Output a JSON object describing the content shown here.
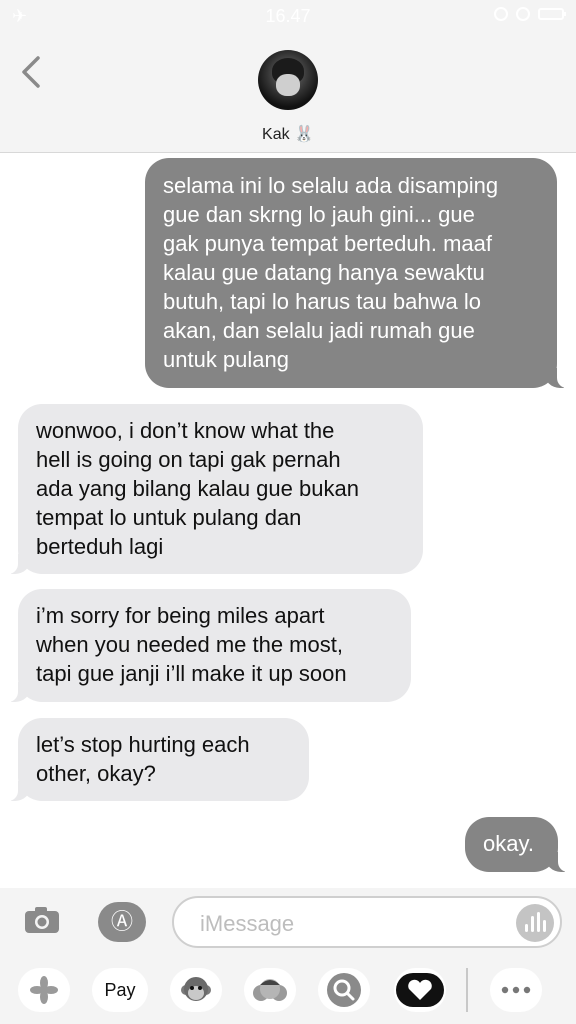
{
  "status": {
    "time": "16.47"
  },
  "header": {
    "contact_name": "Kak 🐰"
  },
  "messages": [
    {
      "from": "me",
      "lines": [
        "selama ini lo selalu ada disamping",
        "gue dan skrng lo jauh gini... gue",
        "gak punya tempat berteduh. maaf",
        "kalau gue datang hanya sewaktu",
        "butuh, tapi lo harus tau bahwa lo",
        "akan, dan selalu jadi rumah gue",
        "untuk pulang"
      ]
    },
    {
      "from": "them",
      "lines": [
        "wonwoo, i don’t know what the",
        "hell is going on tapi gak pernah",
        "ada yang bilang kalau gue bukan",
        "tempat lo untuk pulang dan",
        "berteduh lagi"
      ]
    },
    {
      "from": "them",
      "lines": [
        "i’m sorry for being miles apart",
        "when you needed me the most,",
        "tapi gue janji i’ll make it up soon"
      ]
    },
    {
      "from": "them",
      "lines": [
        "let’s stop hurting each",
        "other, okay?"
      ]
    },
    {
      "from": "me",
      "lines": [
        "okay."
      ]
    }
  ],
  "input": {
    "placeholder": "iMessage"
  },
  "app_drawer": {
    "items": [
      {
        "name": "photos",
        "icon": "photos-icon"
      },
      {
        "name": "apple-pay",
        "label": "Pay",
        "icon": "apple-pay-icon"
      },
      {
        "name": "animoji",
        "icon": "monkey-animoji-icon"
      },
      {
        "name": "memoji",
        "icon": "memoji-stickers-icon"
      },
      {
        "name": "search",
        "icon": "image-search-icon"
      },
      {
        "name": "digital-touch",
        "icon": "digital-touch-heart-icon"
      },
      {
        "name": "more",
        "icon": "more-dots-icon"
      }
    ]
  }
}
